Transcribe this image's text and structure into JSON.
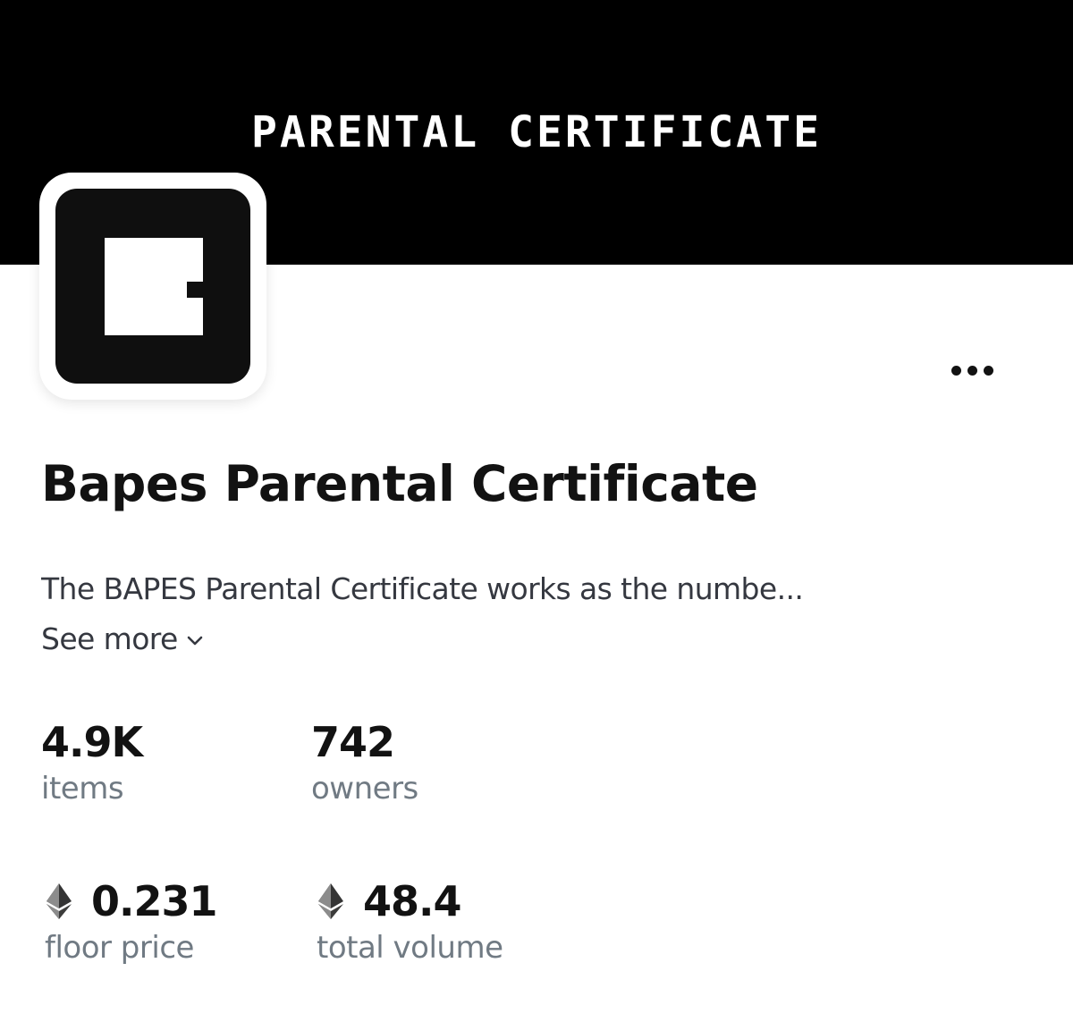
{
  "banner": {
    "title": "PARENTAL CERTIFICATE"
  },
  "collection": {
    "name": "Bapes Parental Certificate",
    "description": "The BAPES Parental Certificate works as the numbe...",
    "see_more_label": "See more",
    "logo_icon": "certificate-logo-icon"
  },
  "menu": {
    "more_icon": "more-horizontal-icon"
  },
  "stats": {
    "items": {
      "value": "4.9K",
      "label": "items"
    },
    "owners": {
      "value": "742",
      "label": "owners"
    },
    "floor_price": {
      "value": "0.231",
      "label": "floor price",
      "currency_icon": "ethereum-icon"
    },
    "total_volume": {
      "value": "48.4",
      "label": "total volume",
      "currency_icon": "ethereum-icon"
    }
  },
  "colors": {
    "banner_bg": "#000000",
    "text_primary": "#121212",
    "text_secondary": "#353840",
    "text_muted": "#707a83"
  }
}
